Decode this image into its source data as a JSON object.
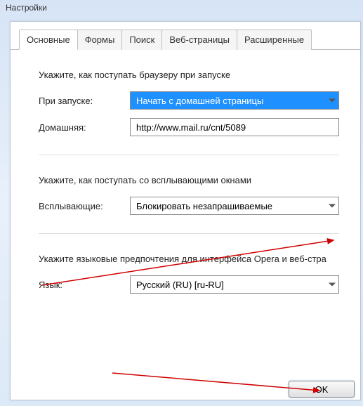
{
  "window": {
    "title": "Настройки"
  },
  "tabs": [
    {
      "label": "Основные"
    },
    {
      "label": "Формы"
    },
    {
      "label": "Поиск"
    },
    {
      "label": "Веб-страницы"
    },
    {
      "label": "Расширенные"
    }
  ],
  "startup": {
    "heading": "Укажите, как поступать браузеру при запуске",
    "on_start_label": "При запуске:",
    "on_start_value": "Начать с домашней страницы",
    "home_label": "Домашняя:",
    "home_value": "http://www.mail.ru/cnt/5089"
  },
  "popups": {
    "heading": "Укажите, как поступать со всплывающими окнами",
    "label": "Всплывающие:",
    "value": "Блокировать незапрашиваемые"
  },
  "language": {
    "heading": "Укажите языковые предпочтения для интерфейса Opera и веб-стра",
    "label": "Язык:",
    "value": "Русский (RU) [ru-RU]"
  },
  "buttons": {
    "ok": "OK"
  }
}
